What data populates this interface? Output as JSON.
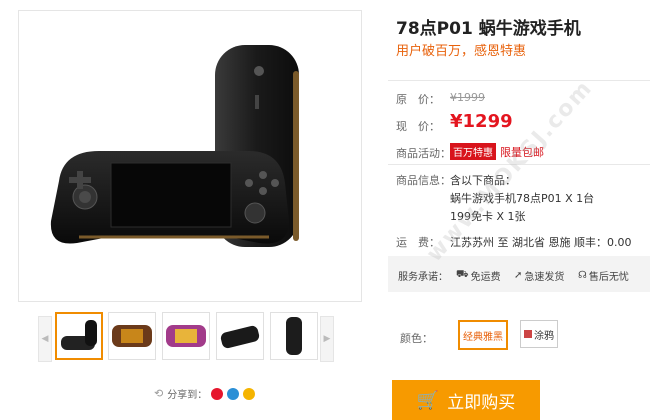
{
  "product": {
    "title": "78点P01 蜗牛游戏手机",
    "subtitle": "用户破百万，感恩特惠"
  },
  "price": {
    "original_label": "原　价：",
    "original_value": "¥1999",
    "current_label": "现　价：",
    "current_value": "¥1299"
  },
  "promotion": {
    "label": "商品活动：",
    "badge": "百万特惠",
    "text": "限量包邮"
  },
  "info": {
    "label": "商品信息：",
    "line1": "含以下商品：",
    "line2": "蜗牛游戏手机78点P01 X 1台",
    "line3": "199免卡 X 1张"
  },
  "shipping": {
    "label": "运　费：",
    "text": "江苏苏州 至 湖北省 恩施  顺丰：0.00"
  },
  "service": {
    "label": "服务承诺：",
    "items": [
      "免运费",
      "急速发货",
      "售后无忧"
    ]
  },
  "color": {
    "label": "颜色：",
    "options": [
      "经典雅黑",
      "涂鸦"
    ],
    "selected": "经典雅黑"
  },
  "share": {
    "label": "分享到："
  },
  "buy_button": {
    "label": "立即购买"
  },
  "watermark": "www.MOKSJ.com",
  "colors": {
    "accent": "#f79a00",
    "price": "#e4151f",
    "subtitle": "#e8620c",
    "badge": "#d8141c"
  }
}
